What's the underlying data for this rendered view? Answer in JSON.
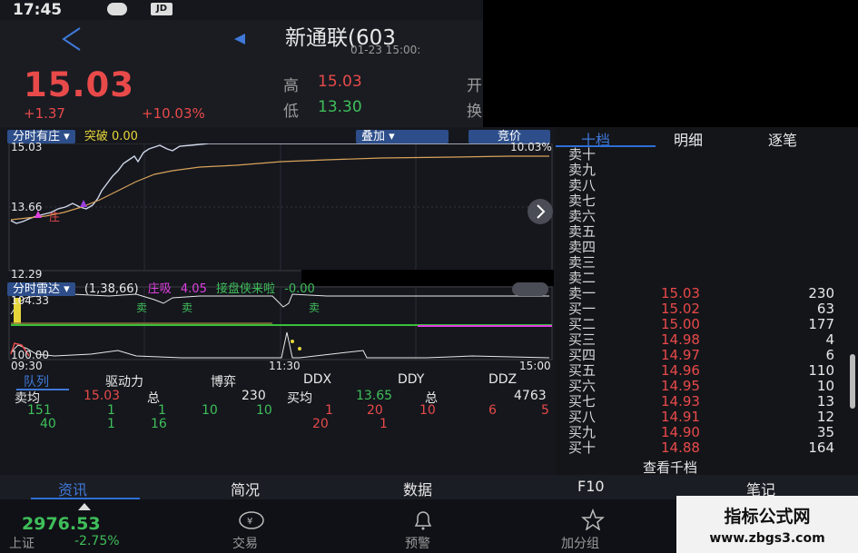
{
  "status": {
    "time": "17:45",
    "badge_jd": "JD"
  },
  "header": {
    "title": "新通联(603",
    "datetime": "01-23 15:00:",
    "price": "15.03",
    "change": "+1.37",
    "change_pct": "+10.03%",
    "high_label": "高",
    "high_value": "15.03",
    "low_label": "低",
    "low_value": "13.30",
    "cut_label_1": "开",
    "cut_label_2": "换"
  },
  "chart": {
    "panel1_dropdown": "分时有庄",
    "breakout_label": "突破",
    "breakout_value": "0.00",
    "overlay_button": "叠加",
    "auction_button": "竞价",
    "ymax": "15.03",
    "ymax_pct": "10.03%",
    "ymid": "13.66",
    "ymin": "12.29",
    "marker_zhuang": "庄",
    "panel2_dropdown": "分时雷达",
    "params": "(1,38,66)",
    "zhuangxi_label": "庄吸",
    "zhuangxi_value": "4.05",
    "jiepan_label": "接盘侠来啦",
    "jiepan_value": "-0.00",
    "radar_top": "104.33",
    "radar_bottom": "100.00",
    "sell_mark": "卖",
    "time_start": "09:30",
    "time_mid": "11:30",
    "time_end": "15:00"
  },
  "subtabs": [
    "队列",
    "驱动力",
    "博弈",
    "DDX",
    "DDY",
    "DDZ"
  ],
  "queue": {
    "sell_avg_label": "卖均",
    "sell_avg_value": "15.03",
    "sell_total_label": "总",
    "sell_total": "230",
    "buy_avg_label": "买均",
    "buy_avg_value": "13.65",
    "buy_total_label": "总",
    "buy_total": "4763",
    "row1": [
      "151",
      "1",
      "1",
      "10",
      "10",
      "1",
      "20",
      "10",
      "6",
      "5"
    ],
    "row2": [
      "40",
      "1",
      "16",
      "20",
      "1"
    ]
  },
  "orderbook": {
    "tabs": [
      "十档",
      "明细",
      "逐笔"
    ],
    "asks": [
      {
        "label": "卖十",
        "price": "",
        "vol": ""
      },
      {
        "label": "卖九",
        "price": "",
        "vol": ""
      },
      {
        "label": "卖八",
        "price": "",
        "vol": ""
      },
      {
        "label": "卖七",
        "price": "",
        "vol": ""
      },
      {
        "label": "卖六",
        "price": "",
        "vol": ""
      },
      {
        "label": "卖五",
        "price": "",
        "vol": ""
      },
      {
        "label": "卖四",
        "price": "",
        "vol": ""
      },
      {
        "label": "卖三",
        "price": "",
        "vol": ""
      },
      {
        "label": "卖二",
        "price": "",
        "vol": ""
      },
      {
        "label": "卖一",
        "price": "15.03",
        "vol": "230"
      }
    ],
    "bids": [
      {
        "label": "买一",
        "price": "15.02",
        "vol": "63"
      },
      {
        "label": "买二",
        "price": "15.00",
        "vol": "177"
      },
      {
        "label": "买三",
        "price": "14.98",
        "vol": "4"
      },
      {
        "label": "买四",
        "price": "14.97",
        "vol": "6"
      },
      {
        "label": "买五",
        "price": "14.96",
        "vol": "110"
      },
      {
        "label": "买六",
        "price": "14.95",
        "vol": "10"
      },
      {
        "label": "买七",
        "price": "14.93",
        "vol": "13"
      },
      {
        "label": "买八",
        "price": "14.91",
        "vol": "12"
      },
      {
        "label": "买九",
        "price": "14.90",
        "vol": "35"
      },
      {
        "label": "买十",
        "price": "14.88",
        "vol": "164"
      }
    ],
    "more": "查看千档"
  },
  "tabs": [
    "资讯",
    "简况",
    "数据",
    "F10",
    "笔记"
  ],
  "bottom": {
    "index_value": "2976.53",
    "index_name": "上证",
    "index_change": "-2.75%",
    "trade": "交易",
    "alert": "预警",
    "add_group": "加分组"
  },
  "watermark": {
    "line1": "指标公式网",
    "line2": "www.zbgs3.com"
  },
  "colors": {
    "up": "#e84a4a",
    "down": "#3fbf5a",
    "accent": "#2d6fd6"
  }
}
